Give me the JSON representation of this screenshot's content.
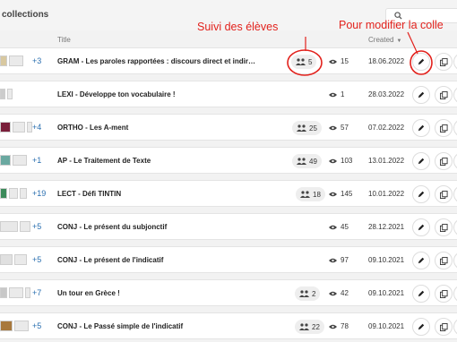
{
  "header": {
    "title": "collections",
    "search_icon": "search-icon"
  },
  "columns": {
    "title": "Title",
    "created": "Created"
  },
  "annotations": {
    "students": "Suivi des élèves",
    "modify": "Pour modifier la colle"
  },
  "colors": {
    "annotation": "#e2211c",
    "more_link": "#2a6fb0"
  },
  "rows": [
    {
      "more": "+3",
      "title": "GRAM - Les paroles rapportées : discours direct et indir…",
      "students": "5",
      "views": "15",
      "date": "18.06.2022"
    },
    {
      "more": "",
      "title": "LEXI - Développe ton vocabulaire !",
      "students": "",
      "views": "1",
      "date": "28.03.2022"
    },
    {
      "more": "+4",
      "title": "ORTHO - Les A-ment",
      "students": "25",
      "views": "57",
      "date": "07.02.2022"
    },
    {
      "more": "+1",
      "title": "AP - Le Traitement de Texte",
      "students": "49",
      "views": "103",
      "date": "13.01.2022"
    },
    {
      "more": "+19",
      "title": "LECT - Défi TINTIN",
      "students": "18",
      "views": "145",
      "date": "10.01.2022"
    },
    {
      "more": "+5",
      "title": "CONJ - Le présent du subjonctif",
      "students": "",
      "views": "45",
      "date": "28.12.2021"
    },
    {
      "more": "+5",
      "title": "CONJ - Le présent de l'indicatif",
      "students": "",
      "views": "97",
      "date": "09.10.2021"
    },
    {
      "more": "+7",
      "title": "Un tour en Grèce !",
      "students": "2",
      "views": "42",
      "date": "09.10.2021"
    },
    {
      "more": "+5",
      "title": "CONJ - Le Passé simple de l'indicatif",
      "students": "22",
      "views": "78",
      "date": "09.10.2021"
    }
  ]
}
